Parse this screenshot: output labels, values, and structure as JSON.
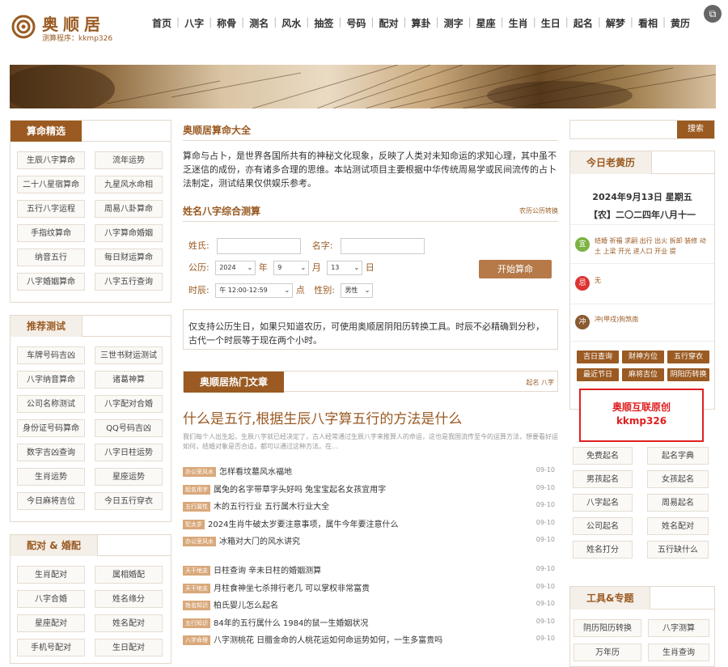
{
  "header": {
    "logo_title": "奥顺居",
    "logo_sub": "测算程序：kkmp326",
    "nav": [
      "首页",
      "八字",
      "称骨",
      "测名",
      "风水",
      "抽签",
      "号码",
      "配对",
      "算卦",
      "测字",
      "星座",
      "生肖",
      "生日",
      "起名",
      "解梦",
      "看相",
      "黄历"
    ],
    "corner_icon": "copy-icon"
  },
  "left": {
    "panel1": {
      "title": "算命精选",
      "items": [
        "生辰八字算命",
        "流年运势",
        "二十八星宿算命",
        "九星风水命相",
        "五行八字运程",
        "周易八卦算命",
        "手指纹算命",
        "八字算命婚姻",
        "纳音五行",
        "每日财运算命",
        "八字婚姻算命",
        "八字五行查询"
      ]
    },
    "panel2": {
      "title": "推荐测试",
      "items": [
        "车牌号码吉凶",
        "三世书财运测试",
        "八字纳音算命",
        "诸葛神算",
        "公司名称测试",
        "八字配对合婚",
        "身份证号码算命",
        "QQ号码吉凶",
        "数字吉凶查询",
        "八字日柱运势",
        "生肖运势",
        "星座运势",
        "今日麻将吉位",
        "今日五行穿衣"
      ]
    },
    "panel3": {
      "title": "配对 & 婚配",
      "items": [
        "生肖配对",
        "属相婚配",
        "八字合婚",
        "姓名缘分",
        "星座配对",
        "姓名配对",
        "手机号配对",
        "生日配对"
      ]
    }
  },
  "main": {
    "intro_title": "奥顺居算命大全",
    "intro_text": "算命与占卜，是世界各国所共有的神秘文化现象，反映了人类对未知命运的求知心理，其中虽不乏迷信的成份，亦有诸多合理的思维。本站测试项目主要根据中华传统周易学或民间流传的占卜法制定，测试结果仅供娱乐参考。",
    "form_title": "姓名八字综合测算",
    "form_link": "农历公历转换",
    "form": {
      "surname_label": "姓氏:",
      "name_label": "名字:",
      "calendar_label": "公历:",
      "year": "2024",
      "year_unit": "年",
      "month": "9",
      "month_unit": "月",
      "day": "13",
      "day_unit": "日",
      "hour_label": "时辰:",
      "hour": "午 12:00-12:59",
      "hour_unit": "点",
      "gender_label": "性别:",
      "gender": "男性",
      "submit": "开始算命"
    },
    "notice": "仅支持公历生日，如果只知道农历，可使用奥顺居阴阳历转换工具。时辰不必精确到分秒，古代一个时辰等于现在两个小时。",
    "articles_title": "奥顺居热门文章",
    "articles_more": "起名 八字",
    "headline": "什么是五行,根据生辰八字算五行的方法是什么",
    "headline_summary": "我们每个人出生起，生辰八字就已经决定了，古人经常通过生辰八字来推算人的命运，这也是我国流传至今的运算方法，想要看好运如何，结婚对象是否合适，都可以通过这种方法。在...",
    "news": [
      {
        "tag": "办公室风水",
        "title": "怎样看坟墓风水福地",
        "date": "09-10"
      },
      {
        "tag": "起名用字",
        "title": "属兔的名字带草字头好吗 兔宝宝起名女孩宜用字",
        "date": "09-10"
      },
      {
        "tag": "五行属性",
        "title": "木的五行行业 五行属木行业大全",
        "date": "09-10"
      },
      {
        "tag": "犯太岁",
        "title": "2024生肖牛破太岁要注意事项，属牛今年要注意什么",
        "date": "09-10"
      },
      {
        "tag": "办公室风水",
        "title": "冰箱对大门的风水讲究",
        "date": "09-10"
      },
      {
        "tag": "天干地支",
        "title": "日柱查询 辛未日柱的婚姻测算",
        "date": "09-10"
      },
      {
        "tag": "天干地支",
        "title": "月柱食神坐七杀排行老几 可以掌权非常富贵",
        "date": "09-10"
      },
      {
        "tag": "姓名知识",
        "title": "柏氏婴儿怎么起名",
        "date": "09-10"
      },
      {
        "tag": "五行知识",
        "title": "84年的五行属什么 1984的鼠一生婚姻状况",
        "date": "09-10"
      },
      {
        "tag": "八字命理",
        "title": "八字测桃花 日腊金命的人桃花运如何命运势如何，一生多富贵吗",
        "date": "09-10"
      }
    ]
  },
  "right": {
    "search_button": "搜索",
    "almanac_title": "今日老黄历",
    "date_solar": "2024年9月13日 星期五",
    "date_lunar": "【农】二〇二四年八月十一",
    "yi_icon": "宜",
    "yi": "结婚 祈福 求嗣 出行 出火 拆卸 装修 动土 上梁 开光 进人口 开业 提",
    "ji_icon": "忌",
    "ji": "无",
    "chong_icon": "冲",
    "chong": "冲(甲戌)狗煞南",
    "tags": [
      "吉日查询",
      "财神方位",
      "五行穿衣",
      "最近节日",
      "麻将吉位",
      "阴阳历转换"
    ],
    "stamp_line1": "奥顺互联原创",
    "stamp_line2": "kkmp326",
    "naming": [
      "免费起名",
      "起名字典",
      "男孩起名",
      "女孩起名",
      "八字起名",
      "周易起名",
      "公司起名",
      "姓名配对",
      "姓名打分",
      "五行缺什么"
    ],
    "tools_title": "工具&专题",
    "tools": [
      "阴历阳历转换",
      "八字测算",
      "万年历",
      "生肖查询"
    ]
  }
}
